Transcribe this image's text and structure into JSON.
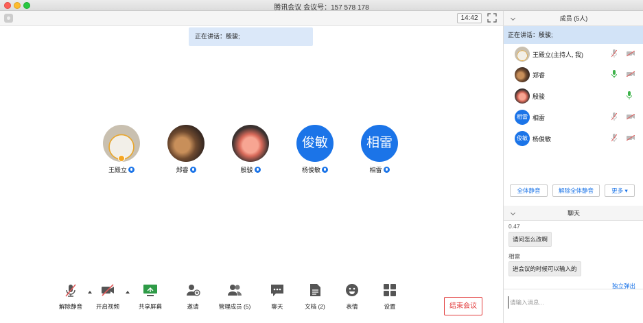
{
  "window": {
    "title": "腾讯会议 会议号：157 578 178"
  },
  "main": {
    "timer": "14:42",
    "speaking_banner": "正在讲话：殷骏;",
    "participants": [
      {
        "name": "王殿立",
        "avatar": "photo",
        "host": true
      },
      {
        "name": "郑睿",
        "avatar": "photo",
        "host": false
      },
      {
        "name": "殷骏",
        "avatar": "photo",
        "host": false
      },
      {
        "name": "杨俊敏",
        "avatar_text": "俊敏",
        "host": false
      },
      {
        "name": "相雷",
        "avatar_text": "相雷",
        "host": false
      }
    ]
  },
  "toolbar": {
    "items": [
      {
        "label": "解除静音",
        "icon": "mic-muted-icon"
      },
      {
        "label": "开启视频",
        "icon": "video-off-icon"
      },
      {
        "label": "共享屏幕",
        "icon": "screen-share-icon"
      },
      {
        "label": "邀请",
        "icon": "invite-icon"
      },
      {
        "label": "管理成员 (5)",
        "icon": "members-icon"
      },
      {
        "label": "聊天",
        "icon": "chat-icon"
      },
      {
        "label": "文档 (2)",
        "icon": "document-icon"
      },
      {
        "label": "表情",
        "icon": "emoji-icon"
      },
      {
        "label": "设置",
        "icon": "settings-icon"
      }
    ],
    "end_meeting": "结束会议"
  },
  "members_panel": {
    "title": "成员 (5人)",
    "speaking": "正在讲话：殷骏;",
    "members": [
      {
        "name": "王殿立(主持人, 我)",
        "mic": "muted",
        "cam": "off"
      },
      {
        "name": "郑睿",
        "mic": "on",
        "cam": "off"
      },
      {
        "name": "殷骏",
        "mic": "on",
        "cam": "none"
      },
      {
        "name": "相雷",
        "avatar_text": "相雷",
        "mic": "muted",
        "cam": "off"
      },
      {
        "name": "杨俊敏",
        "avatar_text": "俊敏",
        "mic": "muted",
        "cam": "off"
      }
    ],
    "mute_all": "全体静音",
    "unmute_all": "解除全体静音",
    "more": "更多"
  },
  "chat_panel": {
    "title": "聊天",
    "messages": [
      {
        "sender": "0.47",
        "text": "请问怎么改啊"
      },
      {
        "sender": "相雷",
        "text": "进会议的时候可以输入的"
      }
    ],
    "popout": "独立弹出",
    "input_placeholder": "请输入消息..."
  },
  "colors": {
    "accent": "#1b74e8",
    "end_meeting": "#e23b3b",
    "mic_on": "#3db34a",
    "muted": "#e05a5a"
  }
}
